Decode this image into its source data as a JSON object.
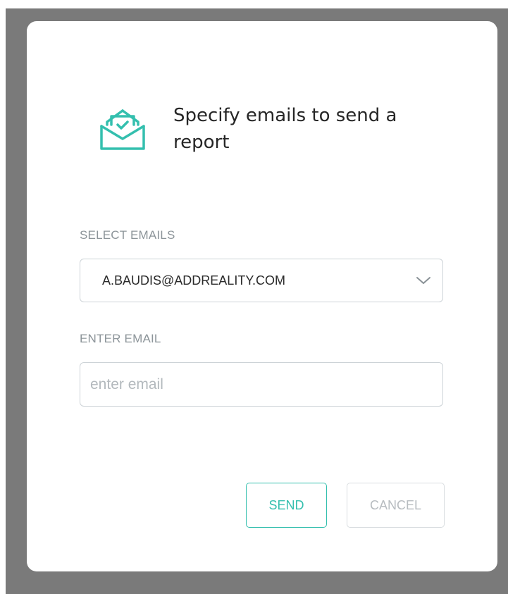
{
  "dialog": {
    "title": "Specify emails to send a report",
    "icon": "open-envelope-check-icon",
    "accent_color": "#34bfae"
  },
  "select_emails": {
    "label": "SELECT EMAILS",
    "selected_value": "A.BAUDIS@ADDREALITY.COM",
    "icon": "chevron-down-icon"
  },
  "enter_email": {
    "label": "ENTER EMAIL",
    "value": "",
    "placeholder": "enter email"
  },
  "actions": {
    "send_label": "SEND",
    "cancel_label": "CANCEL"
  }
}
